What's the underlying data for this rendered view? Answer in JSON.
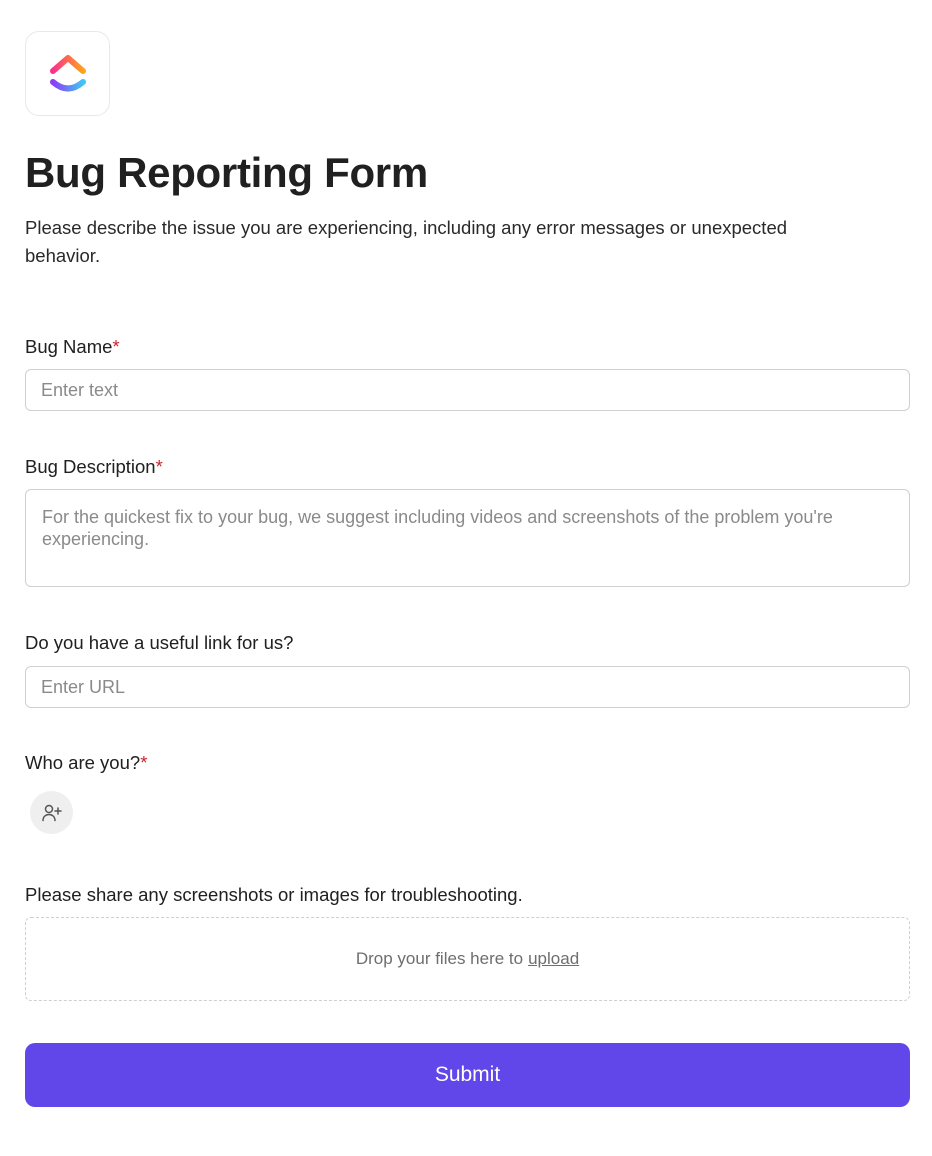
{
  "form": {
    "title": "Bug Reporting Form",
    "description": "Please describe the issue you are experiencing, including any error messages or unexpected behavior."
  },
  "fields": {
    "bug_name": {
      "label": "Bug Name",
      "required_mark": "*",
      "placeholder": "Enter text",
      "value": ""
    },
    "bug_description": {
      "label": "Bug Description",
      "required_mark": "*",
      "placeholder": "For the quickest fix to your bug, we suggest including videos and screenshots of the problem you're experiencing.",
      "value": ""
    },
    "useful_link": {
      "label": "Do you have a useful link for us?",
      "placeholder": "Enter URL",
      "value": ""
    },
    "who_are_you": {
      "label": "Who are you?",
      "required_mark": "*",
      "icon": "person-add-icon"
    },
    "attachments": {
      "label": "Please share any screenshots or images for troubleshooting.",
      "drop_text": "Drop your files here to",
      "upload_link": "upload"
    }
  },
  "submit": {
    "label": "Submit"
  },
  "colors": {
    "accent": "#6147e9",
    "required": "#c8262a"
  },
  "logo": {
    "icon": "clickup-logo-icon"
  }
}
